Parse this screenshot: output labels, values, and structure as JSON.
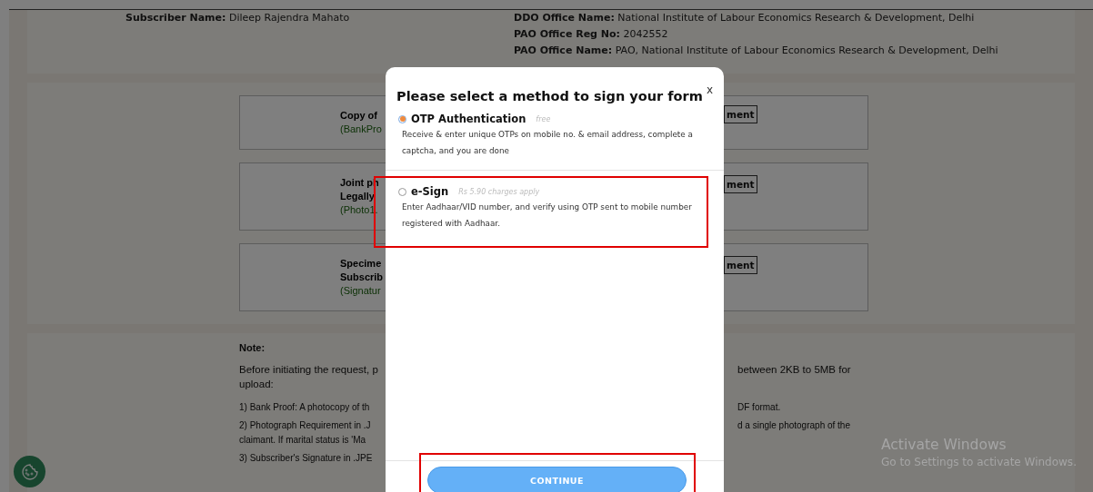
{
  "subscriber": {
    "fields": [
      {
        "label": "Subscriber Name:",
        "value": "Dileep Rajendra Mahato"
      }
    ]
  },
  "office": {
    "fields": [
      {
        "label": "DDO Office Name:",
        "value": "National Institute of Labour Economics Research & Development, Delhi"
      },
      {
        "label": "PAO Office Reg No:",
        "value": "2042552"
      },
      {
        "label": "PAO Office Name:",
        "value": "PAO, National Institute of Labour Economics Research & Development, Delhi"
      }
    ]
  },
  "documents": [
    {
      "lines": [
        {
          "text": "Copy of",
          "kind": "title"
        },
        {
          "text": "(BankPro",
          "kind": "hint"
        }
      ],
      "button": "ment"
    },
    {
      "lines": [
        {
          "text": "Joint ph",
          "kind": "title"
        },
        {
          "text": "Legally",
          "kind": "title"
        },
        {
          "text": "(Photo1.",
          "kind": "hint"
        }
      ],
      "button": "ment"
    },
    {
      "lines": [
        {
          "text": "Specime",
          "kind": "title"
        },
        {
          "text": "Subscrib",
          "kind": "title"
        },
        {
          "text": "(Signatur",
          "kind": "hint"
        }
      ],
      "button": "ment"
    }
  ],
  "note": {
    "heading": "Note:",
    "intro": {
      "left": "Before initiating the request, p",
      "right": "between 2KB to 5MB for",
      "cont": "upload:"
    },
    "items": [
      {
        "left": "1) Bank Proof: A photocopy of th",
        "right": "DF format."
      },
      {
        "left": "2) Photograph Requirement in .J",
        "right": "d a single photograph of the",
        "cont": "claimant. If marital status is 'Ma"
      },
      {
        "left": "3) Subscriber's Signature in .JPE"
      }
    ]
  },
  "dialog": {
    "title": "Please select a method to sign your form",
    "close": "x",
    "options": [
      {
        "label": "OTP Authentication",
        "note": "free",
        "description": "Receive & enter unique OTPs on mobile no. & email address, complete a captcha, and you are done",
        "selected": true
      },
      {
        "label": "e-Sign",
        "note": "Rs 5.90 charges apply",
        "description": "Enter Aadhaar/VID number, and verify using OTP sent to mobile number registered with Aadhaar.",
        "selected": false
      }
    ],
    "button": "CONTINUE"
  },
  "system_notice": {
    "title": "Activate Windows",
    "text": "Go to Settings to activate Windows."
  }
}
